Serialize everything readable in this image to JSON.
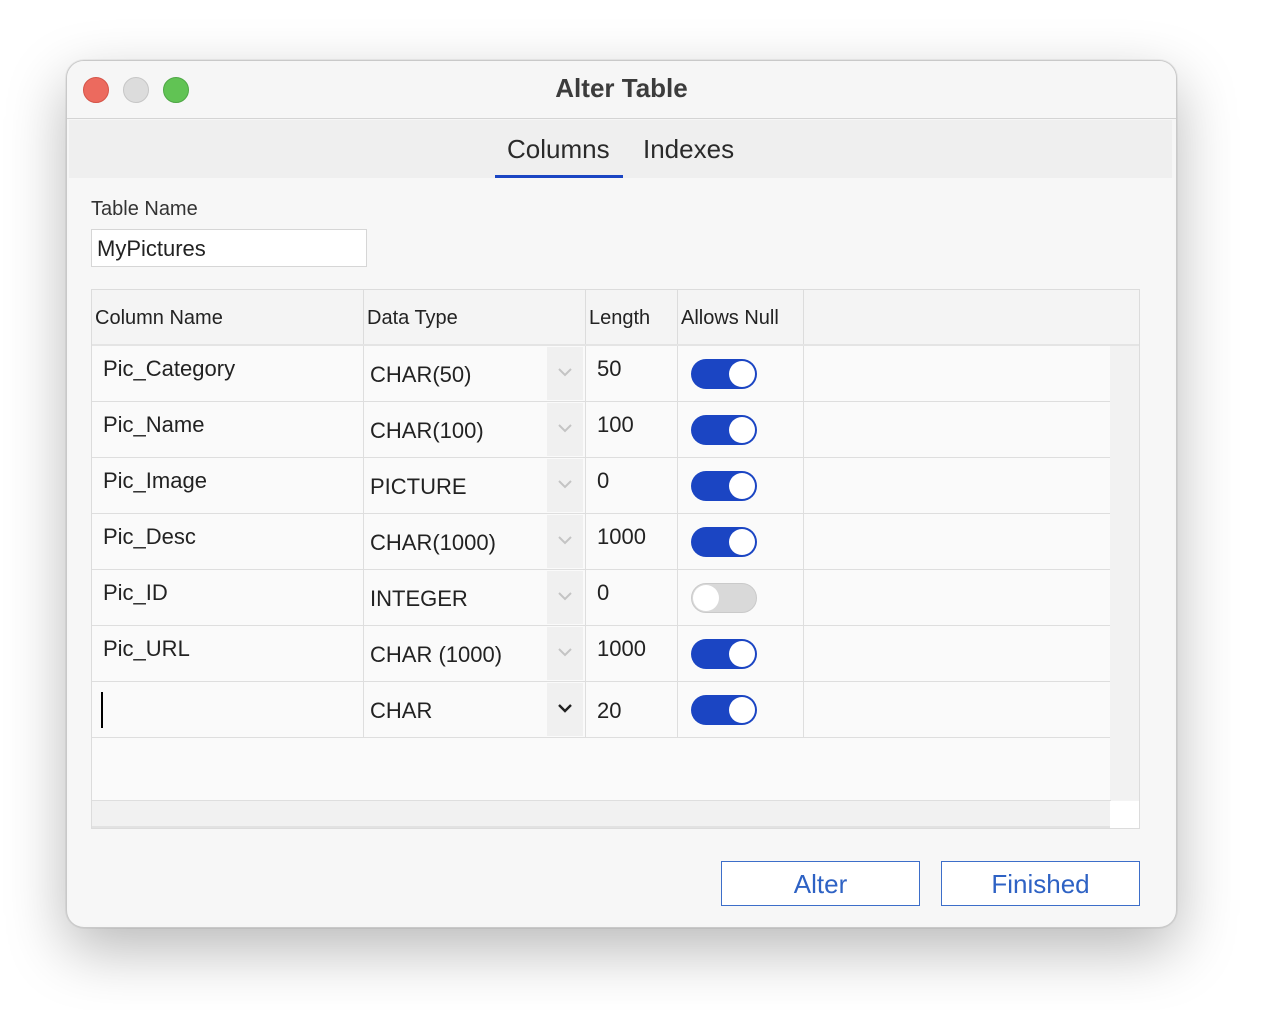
{
  "window": {
    "title": "Alter Table"
  },
  "tabs": [
    {
      "label": "Columns",
      "active": true
    },
    {
      "label": "Indexes",
      "active": false
    }
  ],
  "table_name": {
    "label": "Table Name",
    "value": "MyPictures"
  },
  "grid": {
    "headers": [
      "Column Name",
      "Data Type",
      "Length",
      "Allows Null"
    ],
    "rows": [
      {
        "name": "Pic_Category",
        "type": "CHAR(50)",
        "length": "50",
        "allows_null": true
      },
      {
        "name": "Pic_Name",
        "type": "CHAR(100)",
        "length": "100",
        "allows_null": true
      },
      {
        "name": "Pic_Image",
        "type": "PICTURE",
        "length": "0",
        "allows_null": true
      },
      {
        "name": "Pic_Desc",
        "type": "CHAR(1000)",
        "length": "1000",
        "allows_null": true
      },
      {
        "name": "Pic_ID",
        "type": "INTEGER",
        "length": "0",
        "allows_null": false
      },
      {
        "name": "Pic_URL",
        "type": "CHAR (1000)",
        "length": "1000",
        "allows_null": true
      },
      {
        "name": "",
        "type": "CHAR",
        "length": "20",
        "allows_null": true
      }
    ]
  },
  "buttons": {
    "alter": "Alter",
    "finished": "Finished"
  },
  "colors": {
    "accent": "#1b45c3",
    "button_text": "#2e62c4",
    "toggle_off": "#d9d9d9",
    "close": "#ec6a5e",
    "minimize": "#dcdcdc",
    "maximize": "#61c354"
  }
}
